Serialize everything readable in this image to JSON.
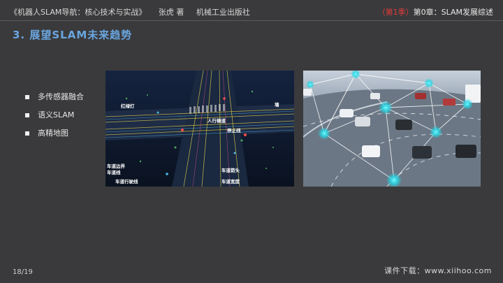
{
  "header": {
    "book_title": "《机器人SLAM导航：核心技术与实战》",
    "author": "张虎 著",
    "publisher": "机械工业出版社",
    "lesson_tag": "（第1季）",
    "chapter": "第0章：SLAM发展综述"
  },
  "section_title": "3. 展望SLAM未来趋势",
  "bullets": [
    "多传感器融合",
    "语义SLAM",
    "高精地图"
  ],
  "hd_map_labels": {
    "traffic_light": "红绿灯",
    "wall": "墙",
    "crosswalk": "人行横道",
    "stop_line": "停止线",
    "lane_boundary": "车道边界",
    "lane_line": "车道线",
    "lane_arrow": "车道箭头",
    "lane_path": "车道行驶线",
    "lane_width": "车道宽度"
  },
  "footer": {
    "page": "18/19",
    "download": "课件下载：www.xiihoo.com"
  }
}
